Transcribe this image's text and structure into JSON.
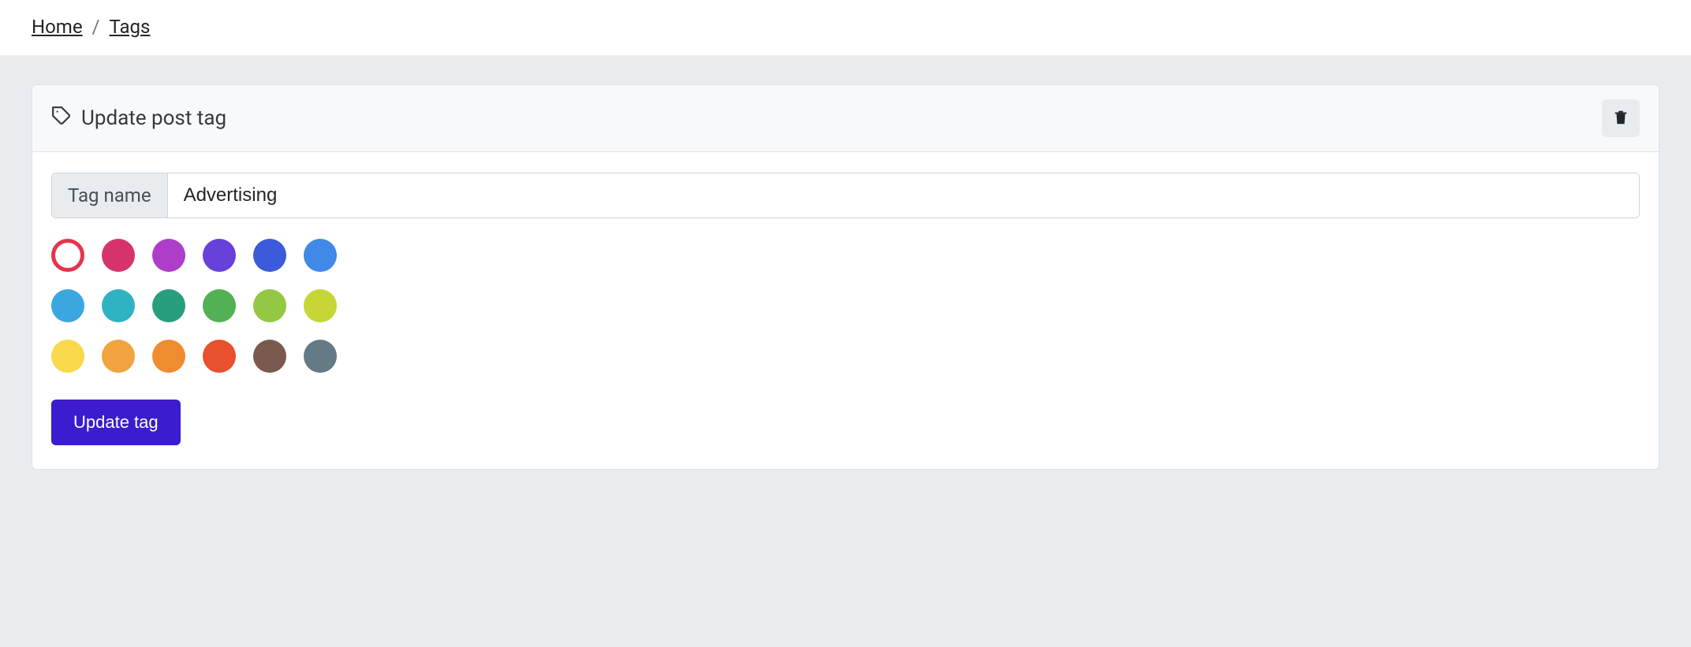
{
  "breadcrumb": {
    "home": "Home",
    "tags": "Tags",
    "sep": "/"
  },
  "card": {
    "title": "Update post tag",
    "delete_aria": "Delete tag"
  },
  "form": {
    "label": "Tag name",
    "value": "Advertising",
    "submit": "Update tag"
  },
  "colors": {
    "selected_index": 0,
    "rows": [
      [
        "#e6344a",
        "#d6336c",
        "#ae3ec9",
        "#6741d9",
        "#3b5bdb",
        "#4189e6"
      ],
      [
        "#3aa7e0",
        "#2fb3c2",
        "#279e7d",
        "#51b154",
        "#93c744",
        "#c5d636"
      ],
      [
        "#f8d94b",
        "#f0a33e",
        "#ef8c2f",
        "#e8502e",
        "#7a5a4f",
        "#647a84"
      ]
    ]
  }
}
